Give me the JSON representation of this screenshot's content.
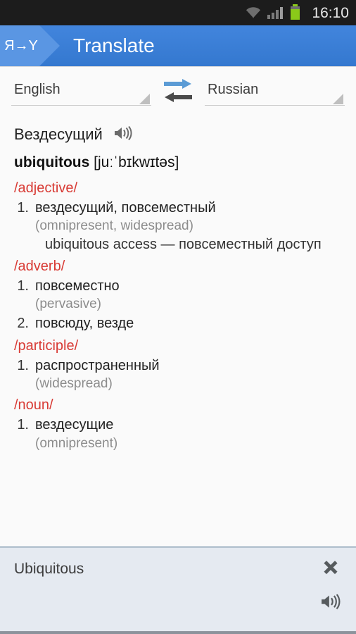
{
  "status_bar": {
    "time": "16:10",
    "icons": [
      "wifi-icon",
      "signal-icon",
      "battery-icon"
    ]
  },
  "action_bar": {
    "logo_text": "Я→Y",
    "title": "Translate"
  },
  "language_selector": {
    "source_language": "English",
    "target_language": "Russian",
    "swap_icon": "swap-arrows-icon",
    "caret_icon": "spinner-caret-icon"
  },
  "translation": {
    "headword": "Вездесущий",
    "speaker_icon": "speaker-icon",
    "source_word": "ubiquitous",
    "transcription": "[juːˈbɪkwɪtəs]",
    "sections": [
      {
        "pos": "/adjective/",
        "senses": [
          {
            "num": "1.",
            "main": "вездесущий, повсеместный",
            "synonyms": "(omnipresent, widespread)",
            "example": "ubiquitous access — повсеместный доступ"
          }
        ]
      },
      {
        "pos": "/adverb/",
        "senses": [
          {
            "num": "1.",
            "main": "повсеместно",
            "synonyms": "(pervasive)",
            "example": ""
          },
          {
            "num": "2.",
            "main": "повсюду, везде",
            "synonyms": "",
            "example": ""
          }
        ]
      },
      {
        "pos": "/participle/",
        "senses": [
          {
            "num": "1.",
            "main": "распространенный",
            "synonyms": "(widespread)",
            "example": ""
          }
        ]
      },
      {
        "pos": "/noun/",
        "senses": [
          {
            "num": "1.",
            "main": "вездесущие",
            "synonyms": "(omnipresent)",
            "example": ""
          }
        ]
      }
    ]
  },
  "bottom_panel": {
    "query_text": "Ubiquitous",
    "close_icon": "close-icon",
    "speaker_icon": "speaker-icon"
  },
  "colors": {
    "action_bar_blue": "#3b7dd8",
    "logo_blue": "#5a96e3",
    "pos_red": "#d83a34",
    "synonym_gray": "#8c8c8c",
    "battery_green": "#8ac919",
    "swap_arrow_blue": "#5b9bd5",
    "swap_arrow_gray": "#4a4a4a",
    "bottom_panel_bg": "#e5eaf1"
  }
}
